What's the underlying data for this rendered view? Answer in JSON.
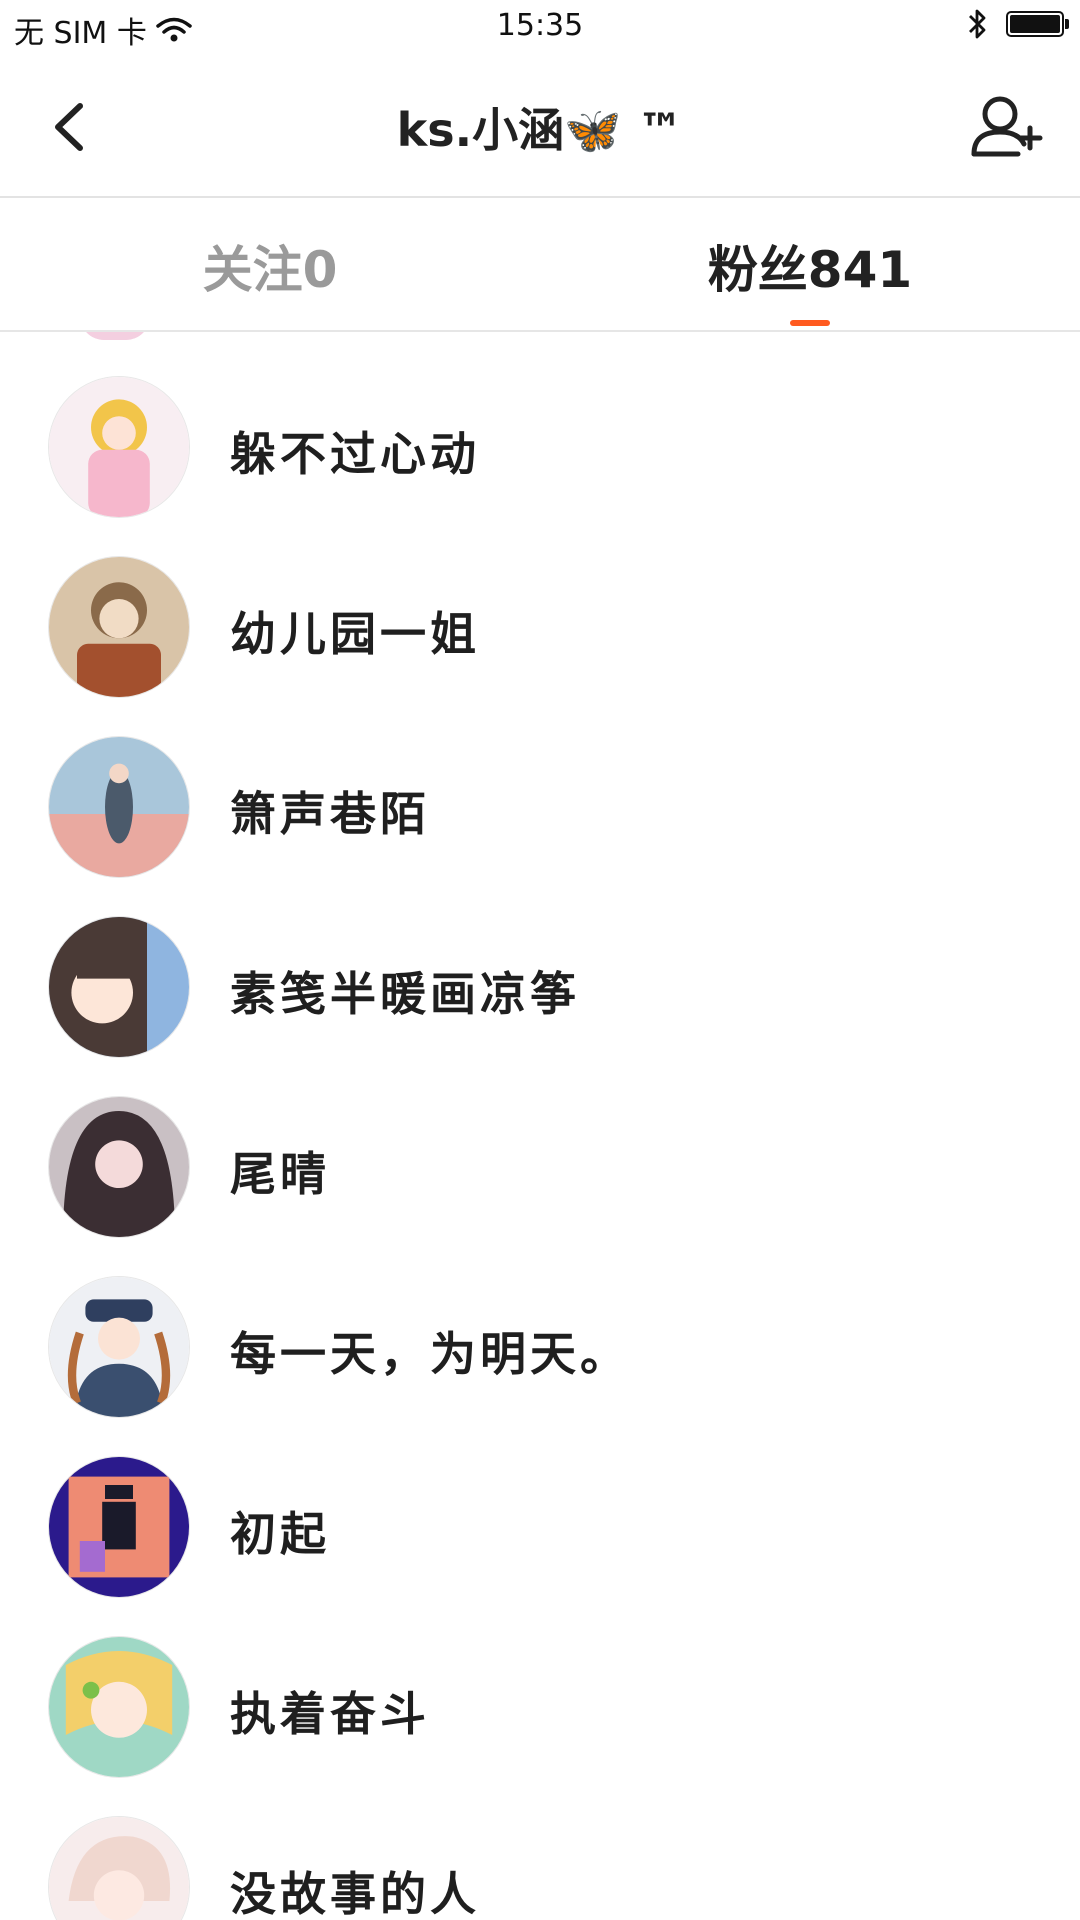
{
  "status_bar": {
    "carrier": "无 SIM 卡",
    "time": "15:35",
    "icons": [
      "wifi-icon",
      "bluetooth-icon",
      "battery-icon"
    ]
  },
  "nav": {
    "title": "ks.小涵🦋 ™",
    "back_icon": "chevron-left-icon",
    "add_user_icon": "add-user-icon"
  },
  "tabs": {
    "following": "关注0",
    "followers": "粉丝841",
    "active": "followers",
    "accent_color": "#ff5a1f"
  },
  "followers": [
    {
      "name": "躲不过心动",
      "avatar_color": "#f6c1d6"
    },
    {
      "name": "幼儿园一姐",
      "avatar_color": "#b07a55"
    },
    {
      "name": "箫声巷陌",
      "avatar_color": "#a9c6da"
    },
    {
      "name": "素笺半暖画凉筝",
      "avatar_color": "#4a3a36"
    },
    {
      "name": "尾晴",
      "avatar_color": "#3b2e33"
    },
    {
      "name": "每一天，为明天。",
      "avatar_color": "#3a4f6f"
    },
    {
      "name": "初起",
      "avatar_color": "#2b1a8c"
    },
    {
      "name": "执着奋斗",
      "avatar_color": "#9fd8c5"
    },
    {
      "name": "没故事的人",
      "avatar_color": "#f0d7cf"
    }
  ]
}
